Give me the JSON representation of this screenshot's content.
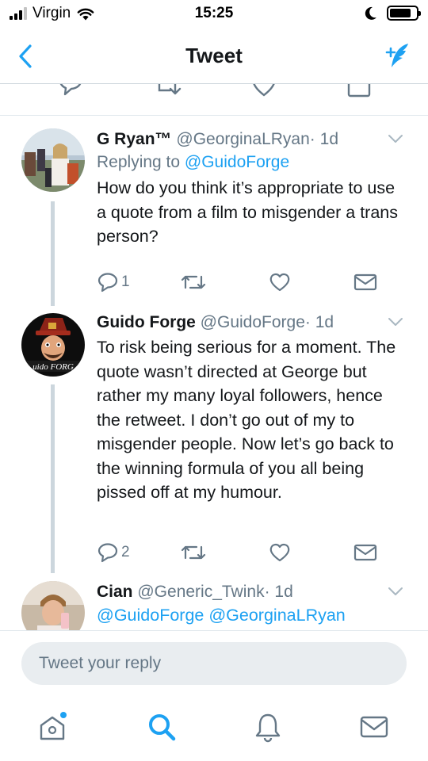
{
  "status_bar": {
    "carrier": "Virgin",
    "time": "15:25",
    "signal_bars_filled": 3,
    "signal_bars_total": 4,
    "battery_level": 0.82
  },
  "nav": {
    "title": "Tweet",
    "back_icon": "chevron-left-icon",
    "compose_icon": "compose-tweet-icon"
  },
  "tweets": [
    {
      "name": "G Ryan™",
      "handle": "@GeorginaLRyan",
      "separator": "·",
      "time": "1d",
      "replying_prefix": "Replying to",
      "replying_to": "@GuidoForge",
      "text": "How do you think it’s appropriate to use a quote from a film to misgender a trans person?",
      "reply_count": "1"
    },
    {
      "name": "Guido Forge",
      "handle": "@GuidoForge",
      "separator": "·",
      "time": "1d",
      "text": "To risk being serious for a moment. The quote wasn’t directed at George but rather my many loyal followers, hence the retweet. I don’t go out of my to misgender people. Now let’s go back to the winning formula of you all being pissed off at my humour.",
      "reply_count": "2",
      "avatar_text": "uido FORG"
    },
    {
      "name": "Cian",
      "handle": "@Generic_Twink",
      "separator": "·",
      "time": "1d",
      "mentions": "@GuidoForge @GeorginaLRyan"
    }
  ],
  "composer": {
    "placeholder": "Tweet your reply"
  },
  "tab_bar": {
    "items": [
      "home-icon",
      "search-icon",
      "notifications-icon",
      "messages-icon"
    ],
    "active": "search-icon",
    "home_has_new_dot": true
  },
  "colors": {
    "accent": "#1da1f2",
    "text": "#14171a",
    "secondary": "#657786",
    "thread_line": "#ccd6dd",
    "composer_bg": "#e9edf0"
  }
}
